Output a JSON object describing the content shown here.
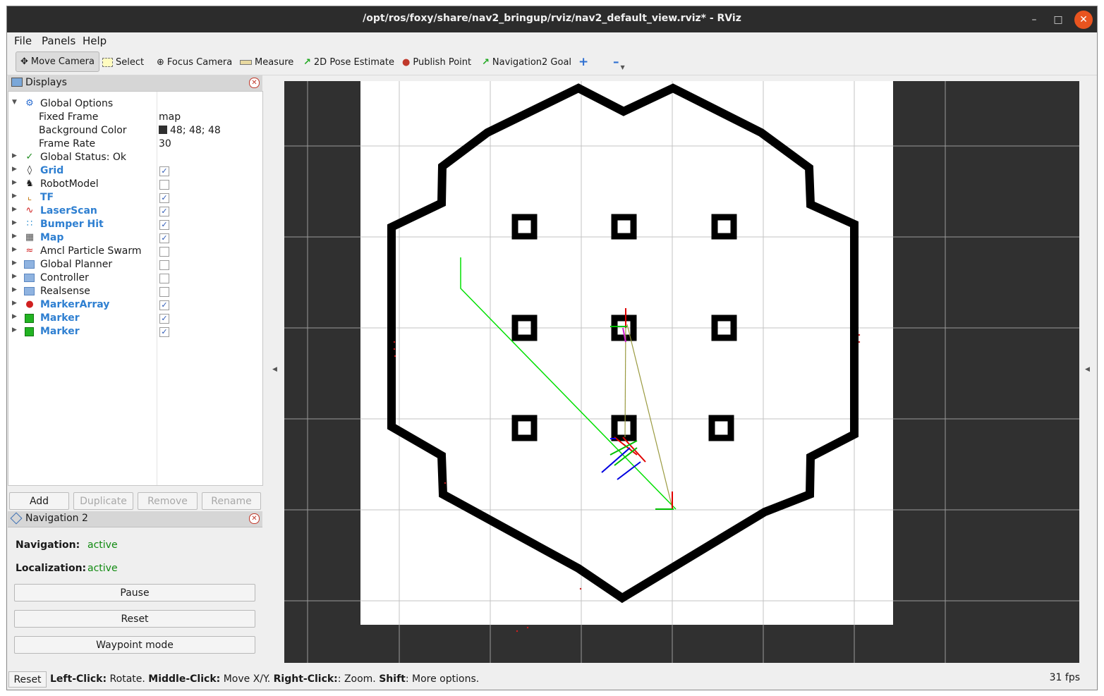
{
  "window": {
    "title": "/opt/ros/foxy/share/nav2_bringup/rviz/nav2_default_view.rviz* - RViz"
  },
  "menu": {
    "file": "File",
    "panels": "Panels",
    "help": "Help"
  },
  "toolbar": {
    "move_camera": "Move Camera",
    "select": "Select",
    "focus_camera": "Focus Camera",
    "measure": "Measure",
    "pose_estimate": "2D Pose Estimate",
    "publish_point": "Publish Point",
    "nav_goal": "Navigation2 Goal"
  },
  "displays": {
    "title": "Displays",
    "global_options": "Global Options",
    "fixed_frame_label": "Fixed Frame",
    "fixed_frame_value": "map",
    "bg_color_label": "Background Color",
    "bg_color_value": "48; 48; 48",
    "frame_rate_label": "Frame Rate",
    "frame_rate_value": "30",
    "global_status": "Global Status: Ok",
    "items": [
      {
        "label": "Grid",
        "checked": true,
        "highlight": true,
        "icon": "grid-icon"
      },
      {
        "label": "RobotModel",
        "checked": false,
        "highlight": false,
        "icon": "robot-icon"
      },
      {
        "label": "TF",
        "checked": true,
        "highlight": true,
        "icon": "tf-icon"
      },
      {
        "label": "LaserScan",
        "checked": true,
        "highlight": true,
        "icon": "laser-icon"
      },
      {
        "label": "Bumper Hit",
        "checked": true,
        "highlight": true,
        "icon": "points-icon"
      },
      {
        "label": "Map",
        "checked": true,
        "highlight": true,
        "icon": "map-icon"
      },
      {
        "label": "Amcl Particle Swarm",
        "checked": false,
        "highlight": false,
        "icon": "particle-icon"
      },
      {
        "label": "Global Planner",
        "checked": false,
        "highlight": false,
        "icon": "folder-icon"
      },
      {
        "label": "Controller",
        "checked": false,
        "highlight": false,
        "icon": "folder-icon"
      },
      {
        "label": "Realsense",
        "checked": false,
        "highlight": false,
        "icon": "folder-icon"
      },
      {
        "label": "MarkerArray",
        "checked": true,
        "highlight": true,
        "icon": "marker-array-icon"
      },
      {
        "label": "Marker",
        "checked": true,
        "highlight": true,
        "icon": "marker-icon"
      },
      {
        "label": "Marker",
        "checked": true,
        "highlight": true,
        "icon": "marker-icon"
      }
    ],
    "buttons": {
      "add": "Add",
      "duplicate": "Duplicate",
      "remove": "Remove",
      "rename": "Rename"
    }
  },
  "nav2": {
    "title": "Navigation 2",
    "navigation_label": "Navigation:",
    "navigation_value": "active",
    "localization_label": "Localization:",
    "localization_value": "active",
    "pause": "Pause",
    "reset": "Reset",
    "waypoint": "Waypoint mode"
  },
  "status": {
    "reset": "Reset",
    "left_key": "Left-Click:",
    "left_val": " Rotate. ",
    "middle_key": "Middle-Click:",
    "middle_val": " Move X/Y. ",
    "right_key": "Right-Click:",
    "right_val": ": Zoom. ",
    "shift_key": "Shift",
    "shift_val": ": More options.",
    "fps": "31 fps"
  },
  "colors": {
    "background": "#303030",
    "status_active": "#108a10",
    "highlight_text": "#2e7fd1",
    "path": "#00e000"
  }
}
